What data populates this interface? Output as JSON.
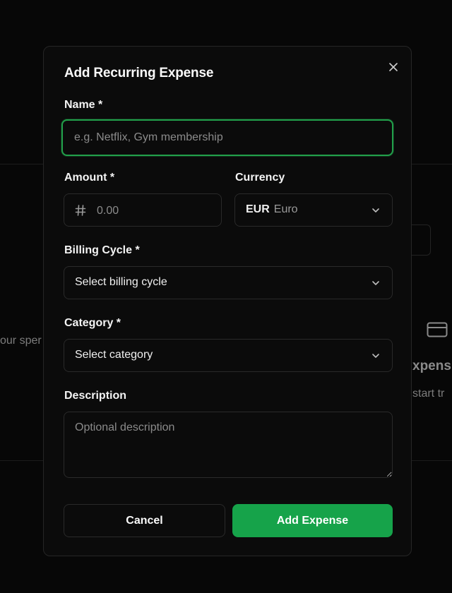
{
  "background": {
    "left_fragment": "our sper",
    "right_heading_fragment": "xpens",
    "right_text_fragment": "start tr",
    "card_icon": "credit-card-icon"
  },
  "dialog": {
    "title": "Add Recurring Expense",
    "close_icon": "close-icon",
    "name": {
      "label": "Name *",
      "placeholder": "e.g. Netflix, Gym membership",
      "value": ""
    },
    "amount": {
      "label": "Amount *",
      "icon": "hash-icon",
      "placeholder": "0.00",
      "value": ""
    },
    "currency": {
      "label": "Currency",
      "code": "EUR",
      "name": "Euro"
    },
    "billing_cycle": {
      "label": "Billing Cycle *",
      "placeholder": "Select billing cycle"
    },
    "category": {
      "label": "Category *",
      "placeholder": "Select category"
    },
    "description": {
      "label": "Description",
      "placeholder": "Optional description",
      "value": ""
    },
    "buttons": {
      "cancel": "Cancel",
      "submit": "Add Expense"
    }
  },
  "colors": {
    "accent": "#16a34a",
    "focus_ring": "#22a04b",
    "modal_bg": "#0b0b0b",
    "border": "#2a2a2a"
  }
}
